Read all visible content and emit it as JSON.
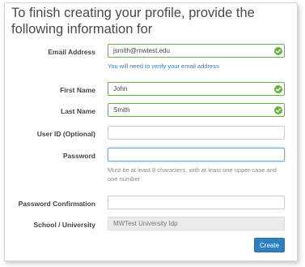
{
  "heading": "To finish creating your profile, provide the following information for",
  "form": {
    "email": {
      "label": "Email Address",
      "value": "jsmith@mwtest.edu",
      "hint": "You will need to verify your email address"
    },
    "first_name": {
      "label": "First Name",
      "value": "John"
    },
    "last_name": {
      "label": "Last Name",
      "value": "Smith"
    },
    "user_id": {
      "label": "User ID (Optional)",
      "value": ""
    },
    "password": {
      "label": "Password",
      "value": "",
      "hint": "Must be at least 8 characters, with at least one upper-case and one number"
    },
    "password_confirmation": {
      "label": "Password Confirmation",
      "value": ""
    },
    "school": {
      "label": "School / University",
      "value": "MWTest University Idp"
    }
  },
  "create_button": "Create",
  "colors": {
    "valid": "#67b33d",
    "accent": "#2f7fbf",
    "focus": "#66afe9"
  },
  "icons": {
    "valid": "check-circle-icon"
  }
}
